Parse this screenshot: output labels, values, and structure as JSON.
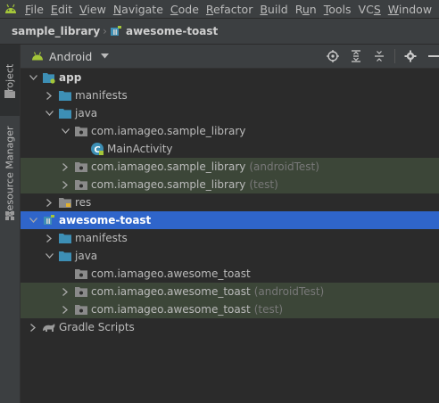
{
  "menubar": {
    "items": [
      {
        "pre": "",
        "mn": "F",
        "post": "ile"
      },
      {
        "pre": "",
        "mn": "E",
        "post": "dit"
      },
      {
        "pre": "",
        "mn": "V",
        "post": "iew"
      },
      {
        "pre": "",
        "mn": "N",
        "post": "avigate"
      },
      {
        "pre": "",
        "mn": "C",
        "post": "ode"
      },
      {
        "pre": "",
        "mn": "R",
        "post": "efactor"
      },
      {
        "pre": "",
        "mn": "B",
        "post": "uild"
      },
      {
        "pre": "R",
        "mn": "u",
        "post": "n"
      },
      {
        "pre": "",
        "mn": "T",
        "post": "ools"
      },
      {
        "pre": "VC",
        "mn": "S",
        "post": ""
      },
      {
        "pre": "",
        "mn": "W",
        "post": "indow"
      }
    ]
  },
  "breadcrumb": {
    "project": "sample_library",
    "module": "awesome-toast"
  },
  "side_tabs": {
    "project": "Project",
    "resource_manager": "Resource Manager"
  },
  "toolbar": {
    "view_mode": "Android"
  },
  "tree": [
    {
      "label": "app",
      "bold": true,
      "icon": "app-module-icon",
      "arrow": "expanded",
      "depth": 0
    },
    {
      "label": "manifests",
      "icon": "folder-icon",
      "arrow": "collapsed",
      "depth": 1
    },
    {
      "label": "java",
      "icon": "folder-icon",
      "arrow": "expanded",
      "depth": 1
    },
    {
      "label": "com.iamageo.sample_library",
      "icon": "package-icon",
      "arrow": "expanded",
      "depth": 2
    },
    {
      "label": "MainActivity",
      "icon": "class-icon",
      "arrow": "none",
      "depth": 3
    },
    {
      "label": "com.iamageo.sample_library",
      "suffix": "(androidTest)",
      "icon": "package-icon",
      "arrow": "collapsed",
      "depth": 2,
      "test": true
    },
    {
      "label": "com.iamageo.sample_library",
      "suffix": "(test)",
      "icon": "package-icon",
      "arrow": "collapsed",
      "depth": 2,
      "test": true
    },
    {
      "label": "res",
      "icon": "res-folder-icon",
      "arrow": "collapsed",
      "depth": 1
    },
    {
      "label": "awesome-toast",
      "bold": true,
      "icon": "library-module-icon",
      "arrow": "expanded",
      "depth": 0,
      "selected": true
    },
    {
      "label": "manifests",
      "icon": "folder-icon",
      "arrow": "collapsed",
      "depth": 1
    },
    {
      "label": "java",
      "icon": "folder-icon",
      "arrow": "expanded",
      "depth": 1
    },
    {
      "label": "com.iamageo.awesome_toast",
      "icon": "package-icon",
      "arrow": "none",
      "depth": 2
    },
    {
      "label": "com.iamageo.awesome_toast",
      "suffix": "(androidTest)",
      "icon": "package-icon",
      "arrow": "collapsed",
      "depth": 2,
      "test": true
    },
    {
      "label": "com.iamageo.awesome_toast",
      "suffix": "(test)",
      "icon": "package-icon",
      "arrow": "collapsed",
      "depth": 2,
      "test": true
    },
    {
      "label": "Gradle Scripts",
      "icon": "gradle-icon",
      "arrow": "collapsed",
      "depth": 0
    }
  ],
  "colors": {
    "background": "#2b2b2b",
    "panel": "#3c3f41",
    "selection": "#2f65ca",
    "test_row": "#3c4638",
    "android_green": "#a4c639",
    "folder_blue": "#3d8fb5"
  }
}
